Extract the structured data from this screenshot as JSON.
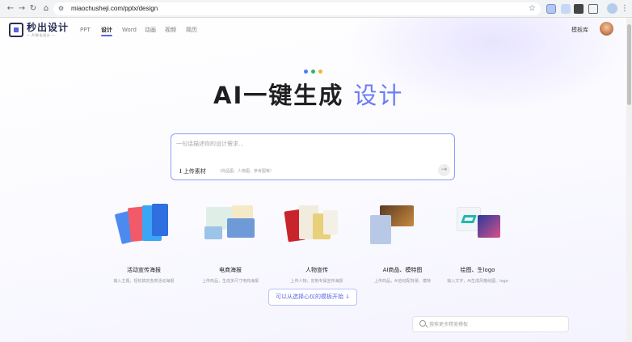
{
  "browser": {
    "url": "miaochusheji.com/pptx/design",
    "back_icon": "arrow-left-icon",
    "forward_icon": "arrow-right-icon",
    "reload_icon": "reload-icon",
    "home_icon": "home-icon"
  },
  "header": {
    "logo_text": "秒出设计",
    "logo_subtext": "— AI秒出设计 —",
    "nav": [
      {
        "label": "PPT",
        "active": false
      },
      {
        "label": "设计",
        "active": true
      },
      {
        "label": "Word",
        "active": false
      },
      {
        "label": "动画",
        "active": false
      },
      {
        "label": "视频",
        "active": false
      },
      {
        "label": "简历",
        "active": false
      }
    ],
    "template_link": "模板库",
    "accent_color": "#5b63e8"
  },
  "hero": {
    "title_main": "AI一键生成",
    "title_accent": "设计",
    "accent_color": "#6b7cf6",
    "dot_colors": [
      "#4a7cf0",
      "#33b36b",
      "#f0b72e"
    ]
  },
  "prompt": {
    "placeholder": "一句话描述你的设计需求...",
    "upload_label": "上传素材",
    "upload_hint": "（商品图、人物图、参考图等）",
    "send_icon": "arrow-right-icon"
  },
  "categories": [
    {
      "title": "活动宣传海报",
      "desc": "输入主题，轻松搞定各类活动海报"
    },
    {
      "title": "电商海报",
      "desc": "上传商品，生成多尺寸电商海报"
    },
    {
      "title": "人物宣传",
      "desc": "上传人物，定制专属宣传海报"
    },
    {
      "title": "AI商品、模特图",
      "desc": "上传商品，AI自动配背景、模特"
    },
    {
      "title": "绘图、生logo",
      "desc": "输入文字，AI生成风格绘图、logo"
    }
  ],
  "cta": {
    "label": "可以从选择心仪的模板开始 ↓"
  },
  "search": {
    "placeholder": "搜索更多精美模板"
  }
}
